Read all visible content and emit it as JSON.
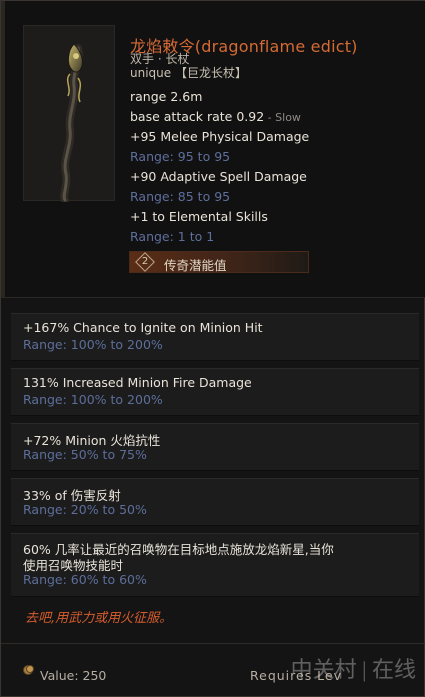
{
  "item": {
    "name": "龙焰敕令(dragonflame edict)",
    "subtype": "双手 · 长杖",
    "rarity": "unique 【巨龙长杖】",
    "range_text": "range 2.6m",
    "attack_rate": "base attack rate 0.92",
    "attack_rate_suffix": " - Slow",
    "implicits": [
      {
        "text": "+95 Melee Physical Damage",
        "range": "Range: 95 to 95"
      },
      {
        "text": "+90 Adaptive Spell Damage",
        "range": "Range: 85 to 95"
      },
      {
        "text": "+1 to Elemental Skills",
        "range": "Range: 1 to 1"
      }
    ],
    "potential_count": "2",
    "potential_label": "传奇潜能值"
  },
  "mods": [
    {
      "text": "+167% Chance to Ignite on Minion Hit",
      "range": "Range: 100% to 200%"
    },
    {
      "text": "131% Increased Minion Fire Damage",
      "range": "Range: 100% to 200%"
    },
    {
      "text": "+72% Minion 火焰抗性",
      "range": "Range: 50% to 75%"
    },
    {
      "text": "33% of 伤害反射",
      "range": "Range: 20% to 50%"
    },
    {
      "text_line1": "60% 几率让最近的召唤物在目标地点施放龙焰新星,当你",
      "text_line2": "使用召唤物技能时",
      "range": "Range: 60% to 60%"
    }
  ],
  "lore": "去吧,用武力或用火征服。",
  "footer": {
    "value": "Value: 250",
    "requires": "Requires Lev",
    "watermark": "中关村 | 在线"
  },
  "colors": {
    "name": "#d46a35",
    "range": "#5f6f9c",
    "lore": "#d35c2e"
  }
}
